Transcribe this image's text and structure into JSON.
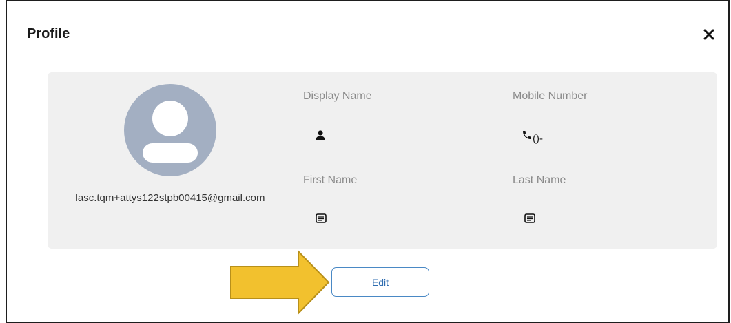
{
  "dialog": {
    "title": "Profile",
    "close_icon": "close-icon"
  },
  "profile": {
    "avatar_icon": "user-avatar-icon",
    "email": "lasc.tqm+attys122stpb00415@gmail.com",
    "fields": {
      "display_name": {
        "label": "Display Name",
        "value": "",
        "icon": "person-icon"
      },
      "mobile_number": {
        "label": "Mobile Number",
        "value": "()-",
        "icon": "phone-icon"
      },
      "first_name": {
        "label": "First Name",
        "value": "",
        "icon": "text-field-icon"
      },
      "last_name": {
        "label": "Last Name",
        "value": "",
        "icon": "text-field-icon"
      }
    }
  },
  "actions": {
    "edit_label": "Edit"
  },
  "annotation": {
    "arrow_color": "#f2c12e",
    "arrow_stroke": "#b8901a"
  },
  "colors": {
    "panel_bg": "#f0f0f0",
    "avatar_bg": "#a3afc2",
    "edit_border": "#4a89c5",
    "edit_text": "#2f6db0"
  }
}
